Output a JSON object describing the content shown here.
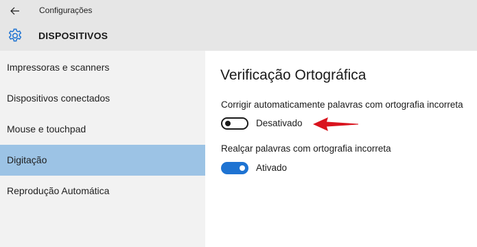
{
  "window": {
    "title": "Configurações",
    "back_icon": "back-arrow-icon"
  },
  "header": {
    "icon": "gear-icon",
    "title": "DISPOSITIVOS"
  },
  "sidebar": {
    "items": [
      {
        "label": "Impressoras e scanners",
        "selected": false
      },
      {
        "label": "Dispositivos conectados",
        "selected": false
      },
      {
        "label": "Mouse e touchpad",
        "selected": false
      },
      {
        "label": "Digitação",
        "selected": true
      },
      {
        "label": "Reprodução Automática",
        "selected": false
      }
    ]
  },
  "main": {
    "section_title": "Verificação Ortográfica",
    "settings": [
      {
        "label": "Corrigir automaticamente palavras com ortografia incorreta",
        "state": "Desativado",
        "on": false
      },
      {
        "label": "Realçar palavras com ortografia incorreta",
        "state": "Ativado",
        "on": true
      }
    ],
    "annotation": "red-arrow-icon"
  },
  "colors": {
    "titlebar_bg": "#e6e6e6",
    "sidebar_bg": "#f2f2f2",
    "selected_bg": "#9cc3e5",
    "accent": "#1e73d2",
    "annotation_red": "#d9141e"
  }
}
